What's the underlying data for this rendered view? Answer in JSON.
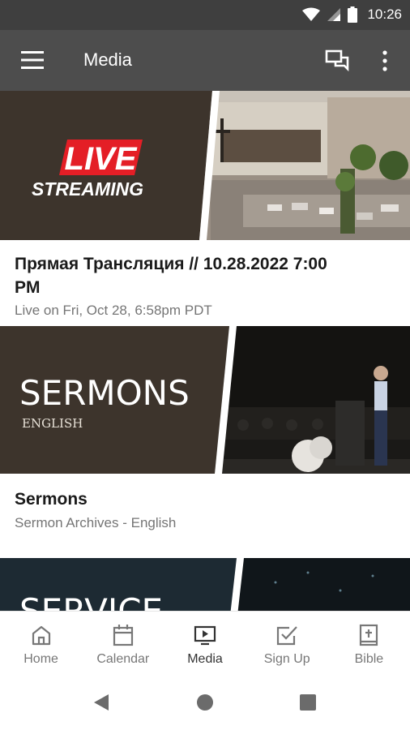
{
  "status_bar": {
    "time": "10:26"
  },
  "app_bar": {
    "title": "Media"
  },
  "media_cards": [
    {
      "banner_top": "LIVE",
      "banner_bottom": "STREAMING",
      "title_line1": "Прямая Трансляция // 10.28.2022 7:00",
      "title_line2": "PM",
      "subtitle": "Live on Fri, Oct 28, 6:58pm PDT"
    },
    {
      "banner_title": "SERMONS",
      "banner_subtitle": "ENGLISH",
      "title": "Sermons",
      "subtitle": "Sermon Archives - English"
    },
    {
      "banner_title": "SERVICE"
    }
  ],
  "bottom_nav": {
    "items": [
      {
        "label": "Home",
        "icon": "home-icon"
      },
      {
        "label": "Calendar",
        "icon": "calendar-icon"
      },
      {
        "label": "Media",
        "icon": "media-icon",
        "active": true
      },
      {
        "label": "Sign Up",
        "icon": "checkbox-icon"
      },
      {
        "label": "Bible",
        "icon": "bible-icon"
      }
    ]
  },
  "colors": {
    "status_bar": "#3f3f3f",
    "app_bar": "#4d4d4d",
    "banner_brown": "#3d342c",
    "live_red": "#e41e26",
    "service_teal": "#1d2a33"
  }
}
